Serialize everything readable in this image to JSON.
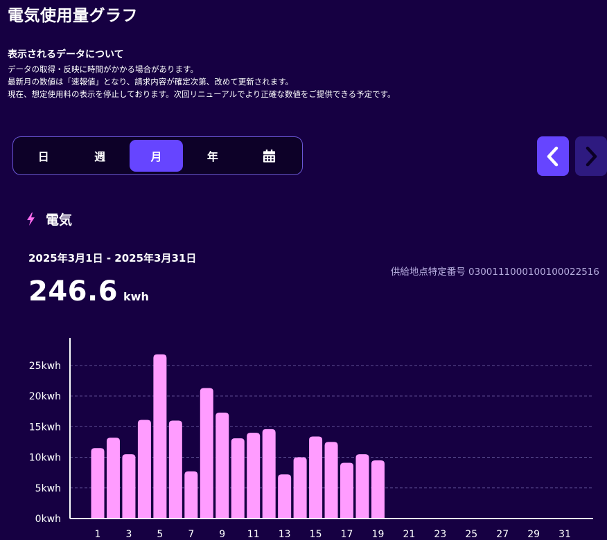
{
  "page": {
    "title": "電気使用量グラフ"
  },
  "notice": {
    "heading": "表示されるデータについて",
    "lines": [
      "データの取得・反映に時間がかかる場合があります。",
      "最新月の数値は「速報値」となり、請求内容が確定次第、改めて更新されます。",
      "現在、想定使用料の表示を停止しております。次回リニューアルでより正確な数値をご提供できる予定です。"
    ]
  },
  "period_tabs": {
    "items": [
      {
        "label": "日"
      },
      {
        "label": "週"
      },
      {
        "label": "月"
      },
      {
        "label": "年"
      },
      {
        "icon": "calendar-icon"
      }
    ],
    "selected": "月"
  },
  "nav": {
    "prev_icon": "chevron-left-icon",
    "next_icon": "chevron-right-icon"
  },
  "section": {
    "icon": "lightning-icon",
    "title": "電気"
  },
  "summary": {
    "date_range": "2025年3月1日 - 2025年3月31日",
    "supply_point": "供給地点特定番号 0300111000100100022516",
    "total_value": "246.6",
    "total_unit": "kwh"
  },
  "colors": {
    "background": "#160042",
    "accent": "#6645ff",
    "bar": "#ff9cff",
    "lightning": "#ff6cf0"
  },
  "chart_data": {
    "type": "bar",
    "x": [
      1,
      2,
      3,
      4,
      5,
      6,
      7,
      8,
      9,
      10,
      11,
      12,
      13,
      14,
      15,
      16,
      17,
      18,
      19,
      20,
      21,
      22,
      23,
      24,
      25,
      26,
      27,
      28,
      29,
      30,
      31
    ],
    "x_tick_labels": [
      "1",
      "3",
      "5",
      "7",
      "9",
      "11",
      "13",
      "15",
      "17",
      "19",
      "21",
      "23",
      "25",
      "27",
      "29",
      "31"
    ],
    "values": [
      11.5,
      13.2,
      10.5,
      16.1,
      26.8,
      16.0,
      7.7,
      21.3,
      17.3,
      13.1,
      14.0,
      14.6,
      7.2,
      10.0,
      13.4,
      12.5,
      9.1,
      10.5,
      9.5,
      null,
      null,
      null,
      null,
      null,
      null,
      null,
      null,
      null,
      null,
      null,
      null
    ],
    "y_ticks": [
      0,
      5,
      10,
      15,
      20,
      25
    ],
    "y_tick_labels": [
      "0kwh",
      "5kwh",
      "10kwh",
      "15kwh",
      "20kwh",
      "25kwh"
    ],
    "ylim": [
      0,
      29.5
    ],
    "grid": true
  }
}
